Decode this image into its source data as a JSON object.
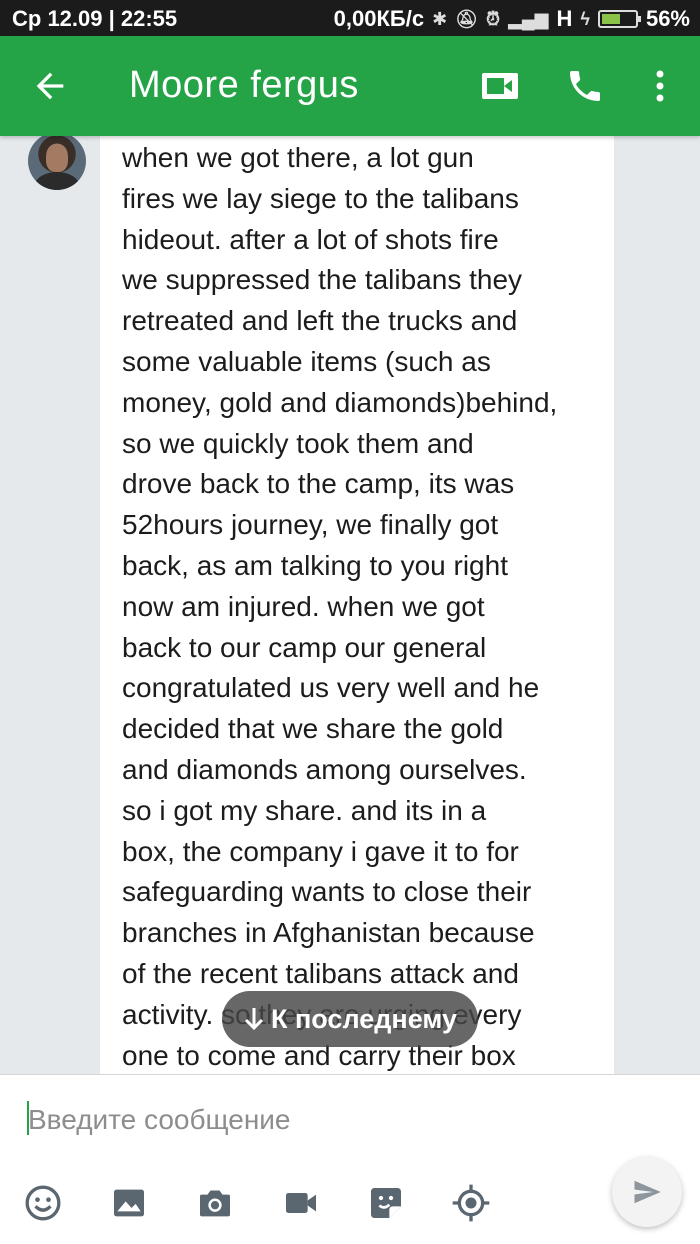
{
  "status_bar": {
    "left": "Ср 12.09 | 22:55",
    "speed": "0,00КБ/с",
    "network": "H",
    "battery_level": 0.56,
    "battery_text": "56%"
  },
  "header": {
    "contact_name": "Moore fergus",
    "icons": [
      "back-arrow-icon",
      "video-call-icon",
      "phone-icon",
      "more-vert-icon"
    ]
  },
  "message": {
    "lines": [
      "when we got there, a lot gun",
      "fires we lay siege to the talibans",
      "hideout. after a lot of shots fire",
      "we suppressed the talibans they",
      "retreated and left the trucks and",
      "some valuable items (such as",
      "money, gold and diamonds)behind,",
      "so we quickly took them and",
      "drove back to the camp, its was",
      "52hours journey, we finally got",
      "back, as am talking to you right",
      "now am injured. when we got",
      "back to our camp our general",
      "congratulated us very well and he",
      "decided that we share the gold",
      "and diamonds among ourselves.",
      "so i got my share. and its in a",
      "box, the company i gave it to for",
      "safeguarding wants to close their",
      "branches in Afghanistan because",
      "of the recent talibans attack and",
      "activity. so they are urging every",
      "one to come and carry their box"
    ]
  },
  "jump_button": {
    "label": "К последнему",
    "icon": "arrow-down-icon"
  },
  "composer": {
    "placeholder": "Введите сообщение",
    "value": "",
    "toolbar": [
      "emoji-icon",
      "gallery-icon",
      "camera-icon",
      "video-icon",
      "sticker-icon",
      "location-icon"
    ],
    "send_icon": "send-icon"
  },
  "colors": {
    "accent": "#25a347",
    "statusbar": "#1b1b1b",
    "background": "#e6e9ec"
  }
}
